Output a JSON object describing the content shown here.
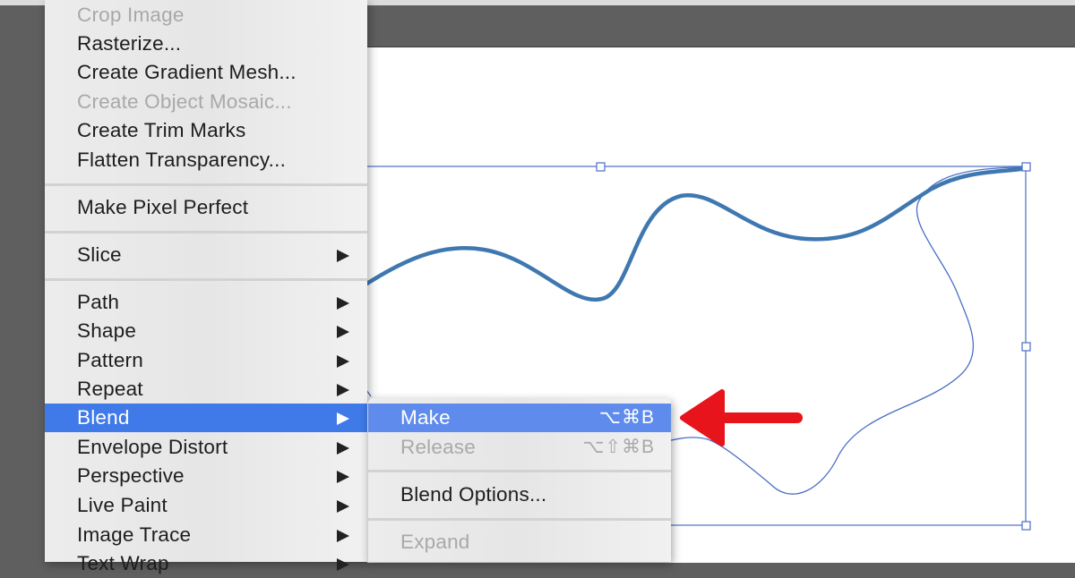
{
  "object_menu": {
    "items": [
      {
        "label": "Crop Image",
        "disabled": true
      },
      {
        "label": "Rasterize..."
      },
      {
        "label": "Create Gradient Mesh..."
      },
      {
        "label": "Create Object Mosaic...",
        "disabled": true
      },
      {
        "label": "Create Trim Marks"
      },
      {
        "label": "Flatten Transparency..."
      },
      {
        "label": "Make Pixel Perfect"
      },
      {
        "label": "Slice",
        "submenu": true
      },
      {
        "label": "Path",
        "submenu": true
      },
      {
        "label": "Shape",
        "submenu": true
      },
      {
        "label": "Pattern",
        "submenu": true
      },
      {
        "label": "Repeat",
        "submenu": true
      },
      {
        "label": "Blend",
        "submenu": true,
        "selected": true
      },
      {
        "label": "Envelope Distort",
        "submenu": true
      },
      {
        "label": "Perspective",
        "submenu": true
      },
      {
        "label": "Live Paint",
        "submenu": true
      },
      {
        "label": "Image Trace",
        "submenu": true
      },
      {
        "label": "Text Wrap",
        "submenu": true
      }
    ]
  },
  "blend_submenu": {
    "items": [
      {
        "label": "Make",
        "shortcut": "⌥⌘B",
        "selected": true
      },
      {
        "label": "Release",
        "shortcut": "⌥⇧⌘B",
        "disabled": true
      },
      {
        "label": "Blend Options..."
      },
      {
        "label": "Expand",
        "disabled": true
      }
    ]
  },
  "annotation": {
    "icon": "red-arrow-icon",
    "color": "#e8141b"
  },
  "colors": {
    "selection_highlight": "#3f7ae8",
    "stroke_path": "#3f78b0",
    "selection_bounds": "#4a6fc4"
  }
}
